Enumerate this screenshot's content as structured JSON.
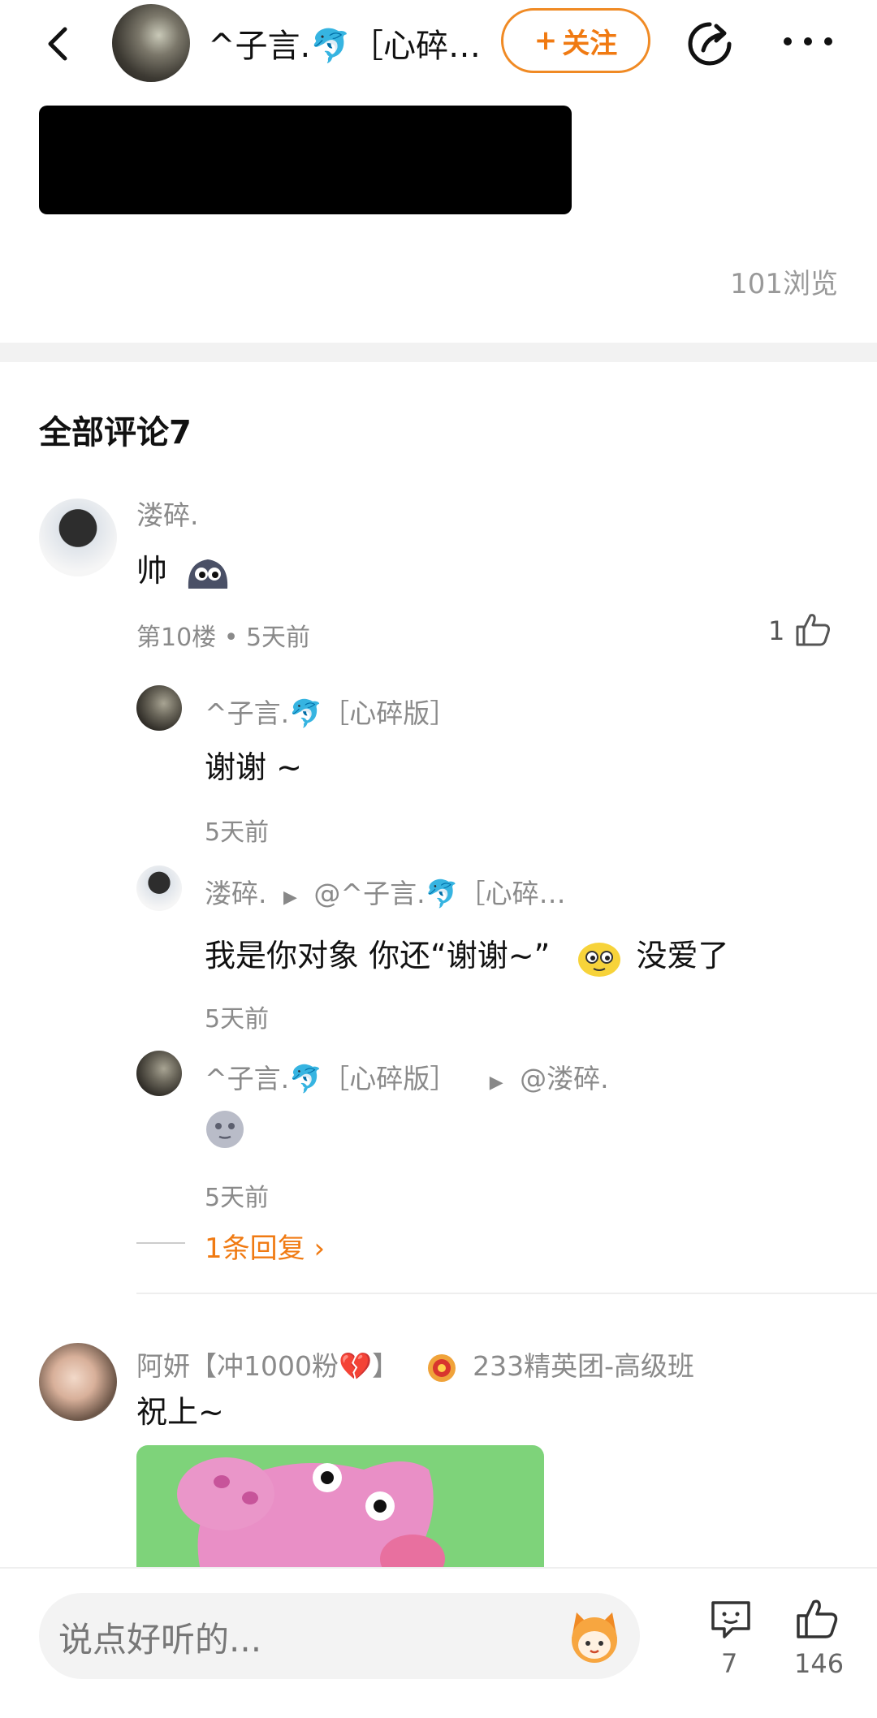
{
  "header": {
    "author_name": "^子言.🐬［心碎…",
    "follow_label": "关注",
    "follow_plus": "+"
  },
  "post": {
    "view_count": "101浏览"
  },
  "comments_section": {
    "title": "全部评论7"
  },
  "comment1": {
    "username": "溇碎.",
    "text": "帅",
    "meta": "第10楼 • 5天前",
    "like_count": "1",
    "replies": [
      {
        "username": "^子言.🐬［心碎版］",
        "text": "谢谢 ~",
        "time": "5天前"
      },
      {
        "username": "溇碎.",
        "arrow": "▶",
        "reply_to": "@^子言.🐬［心碎…",
        "text_a": "我是你对象 你还“谢谢~”",
        "text_b": "没爱了",
        "time": "5天前"
      },
      {
        "username": "^子言.🐬［心碎版］",
        "arrow": "▶",
        "reply_to": "@溇碎.",
        "time": "5天前"
      }
    ],
    "more_replies": "1条回复"
  },
  "comment2": {
    "username": "阿妍【冲1000粉💔】",
    "group_name": "233精英团-高级班",
    "text": "祝上~"
  },
  "bottom_bar": {
    "input_placeholder": "说点好听的...",
    "comment_count": "7",
    "like_count": "146"
  },
  "colors": {
    "accent": "#f07a12",
    "muted_text": "#8a8a8a"
  }
}
